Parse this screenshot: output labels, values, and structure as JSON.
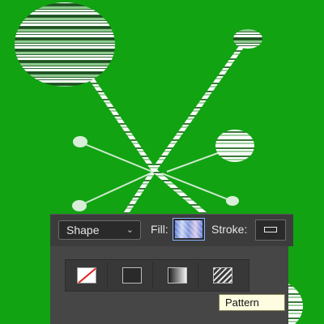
{
  "colors": {
    "canvas_bg": "#11a312",
    "panel_bg": "#3c3c3c",
    "tooltip_bg": "#fffde0"
  },
  "options_bar": {
    "shape_mode": "Shape",
    "shape_mode_icon": "chevron-down-icon",
    "fill_label": "Fill:",
    "stroke_label": "Stroke:",
    "stroke_icon": "rectangle-outline-icon"
  },
  "fill_panel": {
    "types": [
      {
        "name": "none",
        "icon": "no-color-icon"
      },
      {
        "name": "solid",
        "icon": "solid-color-icon"
      },
      {
        "name": "gradient",
        "icon": "gradient-icon"
      },
      {
        "name": "pattern",
        "icon": "pattern-icon"
      }
    ],
    "tooltip": "Pattern"
  }
}
